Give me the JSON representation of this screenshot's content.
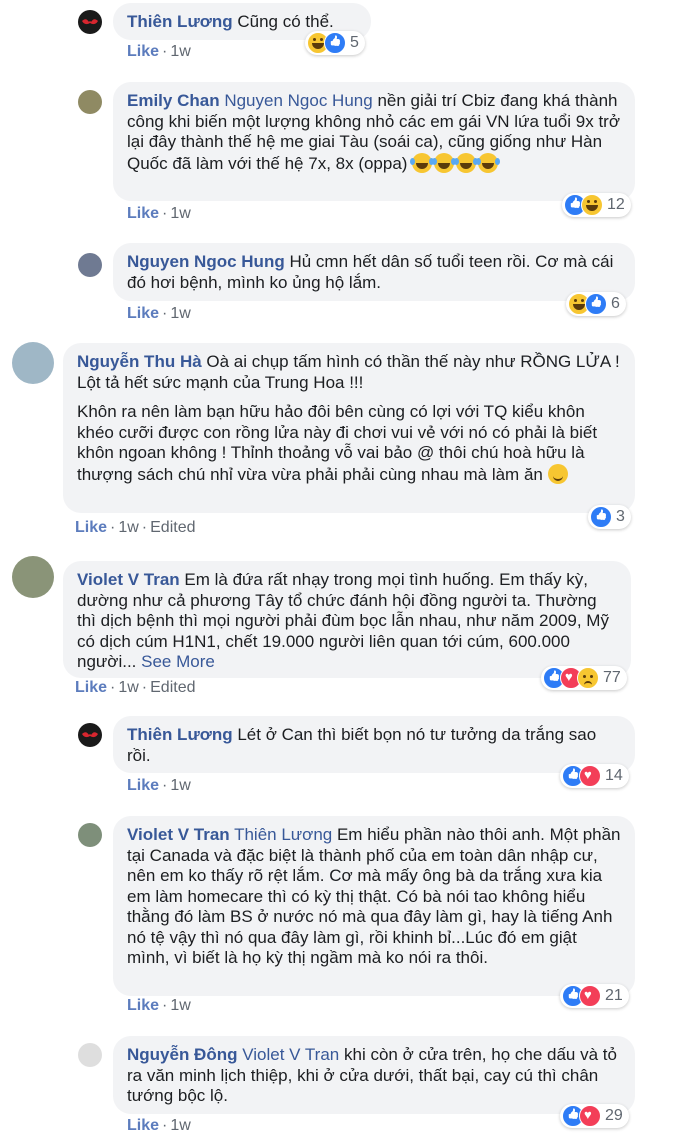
{
  "comments": [
    {
      "author": "Thiên Lương",
      "tag": "",
      "paragraphs": [
        "Cũng có thể."
      ],
      "like": "Like",
      "time": "1w",
      "edited": "",
      "reactions": [
        "haha",
        "like"
      ],
      "count": "5"
    },
    {
      "author": "Emily Chan",
      "tag": "Nguyen Ngoc Hung",
      "paragraphs": [
        "nền giải trí Cbiz đang khá thành công khi biến một lượng không nhỏ các em gái VN lứa tuổi 9x trở lại đây thành thế hệ me giai Tàu (soái ca), cũng giống như Hàn Quốc đã làm với thế hệ 7x, 8x (oppa)"
      ],
      "emojis": 4,
      "like": "Like",
      "time": "1w",
      "edited": "",
      "reactions": [
        "like",
        "haha"
      ],
      "count": "12"
    },
    {
      "author": "Nguyen Ngoc Hung",
      "tag": "",
      "paragraphs": [
        "Hủ cmn hết dân số tuổi teen rồi. Cơ mà cái đó hơi bệnh, mình ko ủng hộ lắm."
      ],
      "like": "Like",
      "time": "1w",
      "edited": "",
      "reactions": [
        "haha",
        "like"
      ],
      "count": "6"
    },
    {
      "author": "Nguyễn Thu Hà",
      "tag": "",
      "paragraphs": [
        "Oà ai chụp tấm hình có thần thế này như RỒNG LỬA ! Lột tả hết sức mạnh của Trung Hoa !!!",
        "Khôn ra nên làm bạn hữu hảo đôi bên cùng có lợi với TQ kiểu khôn khéo cưỡi được con rồng lửa này đi chơi vui vẻ với nó có phải là biết khôn ngoan không ! Thỉnh thoảng vỗ vai bảo @ thôi chú hoà hữu là thượng sách chú nhỉ vừa vừa phải phải cùng nhau mà làm ăn"
      ],
      "like": "Like",
      "time": "1w",
      "edited": "Edited",
      "reactions": [
        "like"
      ],
      "count": "3"
    },
    {
      "author": "Violet V Tran",
      "tag": "",
      "paragraphs": [
        "Em là đứa rất nhạy trong mọi tình huống. Em thấy kỳ, dường như cả phương Tây tổ chức đánh hội đồng người ta. Thường thì dịch bệnh thì mọi người phải đùm bọc lẫn nhau, như năm 2009, Mỹ có dịch cúm H1N1, chết 19.000 người liên quan tới cúm, 600.000 người..."
      ],
      "see_more": "See More",
      "like": "Like",
      "time": "1w",
      "edited": "Edited",
      "reactions": [
        "like",
        "love",
        "sad"
      ],
      "count": "77"
    },
    {
      "author": "Thiên Lương",
      "tag": "",
      "paragraphs": [
        "Lét ở Can thì biết bọn nó tư tưởng da trắng sao rồi."
      ],
      "like": "Like",
      "time": "1w",
      "edited": "",
      "reactions": [
        "like",
        "love"
      ],
      "count": "14"
    },
    {
      "author": "Violet V Tran",
      "tag": "Thiên Lương",
      "paragraphs": [
        "Em hiểu phần nào thôi anh. Một phần tại Canada và đặc biệt là thành phố của em toàn dân nhập cư, nên em ko thấy rõ rệt lắm. Cơ mà mấy ông bà da trắng xưa kia em làm homecare thì có kỳ thị thật. Có bà nói tao không hiểu thằng đó làm BS ở nước nó mà qua đây làm gì, hay là tiếng Anh nó tệ vậy thì nó qua đây làm gì, rồi khinh bỉ...Lúc đó em giật mình, vì biết là họ kỳ thị ngầm mà ko nói ra thôi."
      ],
      "like": "Like",
      "time": "1w",
      "edited": "",
      "reactions": [
        "like",
        "love"
      ],
      "count": "21"
    },
    {
      "author": "Nguyễn Đông",
      "tag": "Violet V Tran",
      "paragraphs": [
        "khi còn ở cửa trên, họ che dấu và tỏ ra văn minh lịch thiệp, khi ở cửa dưới, thất bại, cay cú thì chân tướng bộc lộ."
      ],
      "like": "Like",
      "time": "1w",
      "edited": "",
      "reactions": [
        "like",
        "love"
      ],
      "count": "29"
    }
  ],
  "avatars": [
    "#1a1a1a",
    "#8f8a63",
    "#6f7a92",
    "#9fb7c6",
    "#8a9478",
    "#1a1a1a",
    "#7e8f7a",
    "#dedede"
  ]
}
